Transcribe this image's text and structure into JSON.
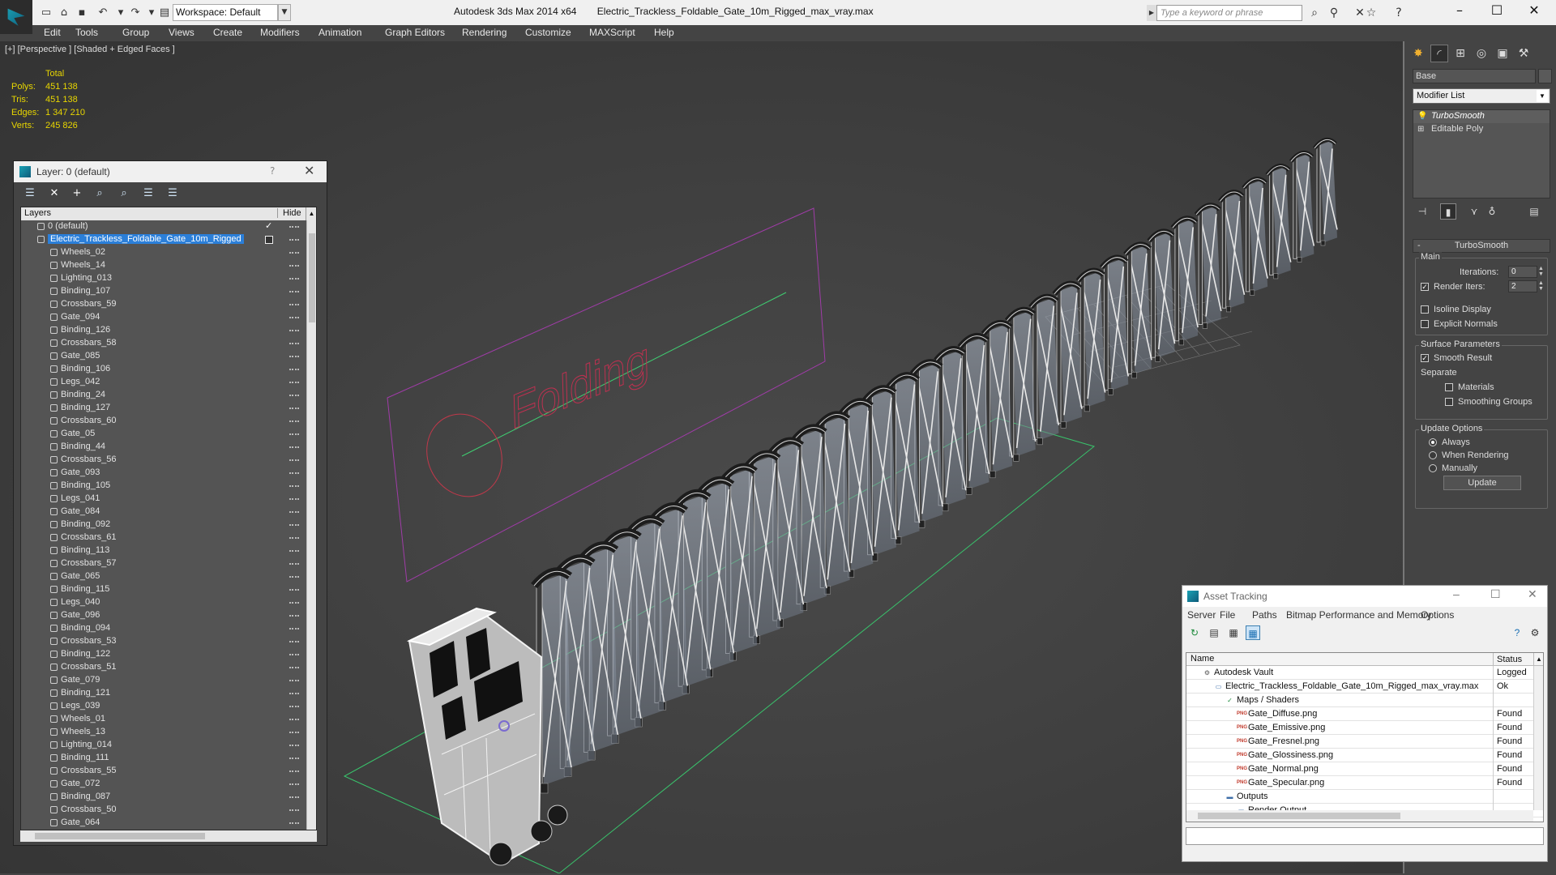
{
  "titlebar": {
    "workspace": "Workspace: Default",
    "app_name": "Autodesk 3ds Max  2014 x64",
    "file_name": "Electric_Trackless_Foldable_Gate_10m_Rigged_max_vray.max",
    "search_placeholder": "Type a keyword or phrase"
  },
  "menu": [
    "Edit",
    "Tools",
    "Group",
    "Views",
    "Create",
    "Modifiers",
    "Animation",
    "Graph Editors",
    "Rendering",
    "Customize",
    "MAXScript",
    "Help"
  ],
  "viewport": {
    "label": "[+] [Perspective ] [Shaded + Edged Faces ]",
    "stats": {
      "header": "Total",
      "rows": [
        {
          "k": "Polys:",
          "v": "451 138"
        },
        {
          "k": "Tris:",
          "v": "451 138"
        },
        {
          "k": "Edges:",
          "v": "1 347 210"
        },
        {
          "k": "Verts:",
          "v": "245 826"
        }
      ]
    },
    "sign_text": "Folding"
  },
  "layer_dialog": {
    "title": "Layer: 0 (default)",
    "help": "?",
    "col_layers": "Layers",
    "col_hide": "Hide",
    "items": [
      {
        "name": "0 (default)",
        "level": 0,
        "state": "check"
      },
      {
        "name": "Electric_Trackless_Foldable_Gate_10m_Rigged",
        "level": 0,
        "state": "box",
        "selected": true
      },
      {
        "name": "Wheels_02",
        "level": 1
      },
      {
        "name": "Wheels_14",
        "level": 1
      },
      {
        "name": "Lighting_013",
        "level": 1
      },
      {
        "name": "Binding_107",
        "level": 1
      },
      {
        "name": "Crossbars_59",
        "level": 1
      },
      {
        "name": "Gate_094",
        "level": 1
      },
      {
        "name": "Binding_126",
        "level": 1
      },
      {
        "name": "Crossbars_58",
        "level": 1
      },
      {
        "name": "Gate_085",
        "level": 1
      },
      {
        "name": "Binding_106",
        "level": 1
      },
      {
        "name": "Legs_042",
        "level": 1
      },
      {
        "name": "Binding_24",
        "level": 1
      },
      {
        "name": "Binding_127",
        "level": 1
      },
      {
        "name": "Crossbars_60",
        "level": 1
      },
      {
        "name": "Gate_05",
        "level": 1
      },
      {
        "name": "Binding_44",
        "level": 1
      },
      {
        "name": "Crossbars_56",
        "level": 1
      },
      {
        "name": "Gate_093",
        "level": 1
      },
      {
        "name": "Binding_105",
        "level": 1
      },
      {
        "name": "Legs_041",
        "level": 1
      },
      {
        "name": "Gate_084",
        "level": 1
      },
      {
        "name": "Binding_092",
        "level": 1
      },
      {
        "name": "Crossbars_61",
        "level": 1
      },
      {
        "name": "Binding_113",
        "level": 1
      },
      {
        "name": "Crossbars_57",
        "level": 1
      },
      {
        "name": "Gate_065",
        "level": 1
      },
      {
        "name": "Binding_115",
        "level": 1
      },
      {
        "name": "Legs_040",
        "level": 1
      },
      {
        "name": "Gate_096",
        "level": 1
      },
      {
        "name": "Binding_094",
        "level": 1
      },
      {
        "name": "Crossbars_53",
        "level": 1
      },
      {
        "name": "Binding_122",
        "level": 1
      },
      {
        "name": "Crossbars_51",
        "level": 1
      },
      {
        "name": "Gate_079",
        "level": 1
      },
      {
        "name": "Binding_121",
        "level": 1
      },
      {
        "name": "Legs_039",
        "level": 1
      },
      {
        "name": "Wheels_01",
        "level": 1
      },
      {
        "name": "Wheels_13",
        "level": 1
      },
      {
        "name": "Lighting_014",
        "level": 1
      },
      {
        "name": "Binding_111",
        "level": 1
      },
      {
        "name": "Crossbars_55",
        "level": 1
      },
      {
        "name": "Gate_072",
        "level": 1
      },
      {
        "name": "Binding_087",
        "level": 1
      },
      {
        "name": "Crossbars_50",
        "level": 1
      },
      {
        "name": "Gate_064",
        "level": 1
      }
    ]
  },
  "command_panel": {
    "object_name": "Base",
    "modifier_list": "Modifier List",
    "stack": [
      {
        "name": "TurboSmooth",
        "active": true
      },
      {
        "name": "Editable Poly",
        "active": false
      }
    ],
    "rollout_title": "TurboSmooth",
    "main_group": "Main",
    "iterations_label": "Iterations:",
    "iterations_value": "0",
    "render_iters_label": "Render Iters:",
    "render_iters_value": "2",
    "isoline_label": "Isoline Display",
    "explicit_normals_label": "Explicit Normals",
    "surface_group": "Surface Parameters",
    "smooth_result_label": "Smooth Result",
    "separate_label": "Separate",
    "materials_label": "Materials",
    "smoothing_groups_label": "Smoothing Groups",
    "update_group": "Update Options",
    "always_label": "Always",
    "when_rendering_label": "When Rendering",
    "manually_label": "Manually",
    "update_button": "Update"
  },
  "asset_tracking": {
    "title": "Asset Tracking",
    "menu": [
      "Server",
      "File",
      "Paths",
      "Bitmap Performance and Memory",
      "Options"
    ],
    "col_name": "Name",
    "col_status": "Status",
    "rows": [
      {
        "name": "Autodesk Vault",
        "indent": 1,
        "icon": "vault-icon",
        "status": "Logged"
      },
      {
        "name": "Electric_Trackless_Foldable_Gate_10m_Rigged_max_vray.max",
        "indent": 2,
        "icon": "max-file-icon",
        "status": "Ok"
      },
      {
        "name": "Maps / Shaders",
        "indent": 3,
        "icon": "maps-folder-icon",
        "status": ""
      },
      {
        "name": "Gate_Diffuse.png",
        "indent": 4,
        "icon": "png-icon",
        "status": "Found"
      },
      {
        "name": "Gate_Emissive.png",
        "indent": 4,
        "icon": "png-icon",
        "status": "Found"
      },
      {
        "name": "Gate_Fresnel.png",
        "indent": 4,
        "icon": "png-icon",
        "status": "Found"
      },
      {
        "name": "Gate_Glossiness.png",
        "indent": 4,
        "icon": "png-icon",
        "status": "Found"
      },
      {
        "name": "Gate_Normal.png",
        "indent": 4,
        "icon": "png-icon",
        "status": "Found"
      },
      {
        "name": "Gate_Specular.png",
        "indent": 4,
        "icon": "png-icon",
        "status": "Found"
      },
      {
        "name": "Outputs",
        "indent": 3,
        "icon": "outputs-folder-icon",
        "status": ""
      },
      {
        "name": "Render Output",
        "indent": 4,
        "icon": "render-output-icon",
        "status": ""
      }
    ]
  }
}
